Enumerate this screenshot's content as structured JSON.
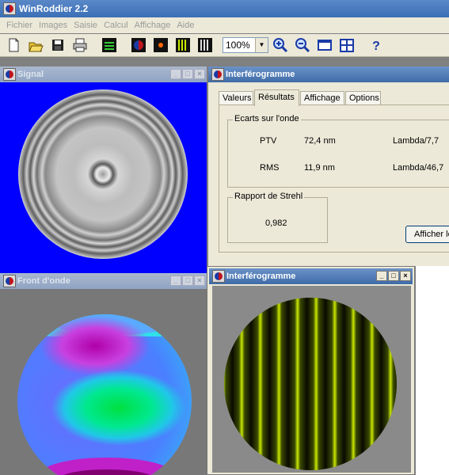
{
  "app": {
    "title": "WinRoddier 2.2"
  },
  "menu": [
    "Fichier",
    "Images",
    "Saisie",
    "Calcul",
    "Affichage",
    "Aide"
  ],
  "toolbar": {
    "zoom_value": "100%",
    "icons": [
      "new-icon",
      "open-folder-icon",
      "save-icon",
      "print-icon",
      "capture-icon",
      "wavefront-icon",
      "point-icon",
      "fringes-icon",
      "grid-icon",
      "zoom-in-icon",
      "zoom-out-icon",
      "tile-horizontal-icon",
      "tile-grid-icon",
      "help-icon"
    ]
  },
  "windows": {
    "signal": {
      "title": "Signal"
    },
    "front": {
      "title": "Front d'onde"
    },
    "results": {
      "title": "Interférogramme",
      "tabs": [
        "Valeurs",
        "Résultats",
        "Affichage",
        "Options"
      ],
      "ecarts": {
        "title": "Ecarts sur l'onde",
        "rows": [
          {
            "label": "PTV",
            "value": "72,4 nm",
            "lambda": "Lambda/7,7"
          },
          {
            "label": "RMS",
            "value": "11,9 nm",
            "lambda": "Lambda/46,7"
          }
        ]
      },
      "strehl": {
        "title": "Rapport de Strehl",
        "value": "0,982"
      },
      "afficher_button": "Afficher le"
    },
    "interferogram": {
      "title": "Interférogramme"
    }
  },
  "colors": {
    "signal_bg": "#0000ff",
    "fringe": "#c8e600"
  }
}
